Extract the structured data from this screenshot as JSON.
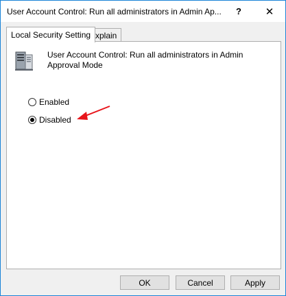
{
  "window": {
    "title": "User Account Control: Run all administrators in Admin Ap...",
    "help_glyph": "?",
    "close_glyph": "✕"
  },
  "tabs": [
    {
      "label": "Local Security Setting",
      "active": true
    },
    {
      "label": "Explain",
      "active": false
    }
  ],
  "policy": {
    "icon": "server-computer-icon",
    "title": "User Account Control: Run all administrators in Admin Approval Mode"
  },
  "options": [
    {
      "label": "Enabled",
      "checked": false
    },
    {
      "label": "Disabled",
      "checked": true
    }
  ],
  "annotation": {
    "arrow_color": "#e8151b"
  },
  "buttons": {
    "ok": "OK",
    "cancel": "Cancel",
    "apply": "Apply"
  }
}
